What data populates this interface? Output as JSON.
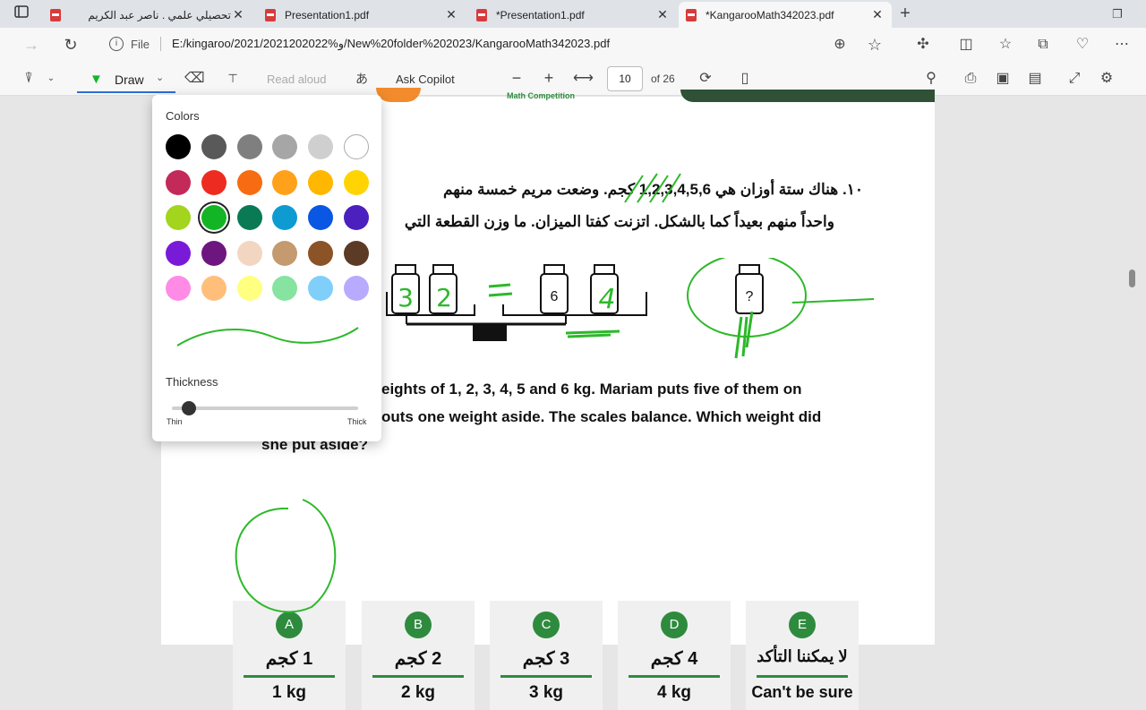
{
  "tabs": [
    {
      "label": "تحصيلي علمي . ناصر عبد الكريم",
      "active": false
    },
    {
      "label": "Presentation1.pdf",
      "active": false
    },
    {
      "label": "*Presentation1.pdf",
      "active": false
    },
    {
      "label": "*KangarooMath342023.pdf",
      "active": true
    }
  ],
  "address": {
    "info_label": "File",
    "url": "E:/kingaroo/2021/2021202022%و/New%20folder%202023/KangarooMath342023.pdf"
  },
  "pdf_toolbar": {
    "draw_label": "Draw",
    "read_aloud_label": "Read aloud",
    "copilot_label": "Ask Copilot",
    "page_number": "10",
    "page_total": "of 26"
  },
  "draw_panel": {
    "colors_heading": "Colors",
    "thickness_heading": "Thickness",
    "thin_label": "Thin",
    "thick_label": "Thick",
    "thickness_value": 0.1,
    "selected_color": "#13b524",
    "colors": [
      "#000000",
      "#595959",
      "#7f7f7f",
      "#a6a6a6",
      "#cfcfcf",
      "#ffffff",
      "#c32a59",
      "#ee2b20",
      "#f76c12",
      "#ffa11a",
      "#ffb700",
      "#ffd400",
      "#a3d41e",
      "#13b524",
      "#0a7a54",
      "#0e9bd1",
      "#0a57e3",
      "#4c1fbf",
      "#7a1ad9",
      "#6e1680",
      "#f3d6c1",
      "#c49a6e",
      "#8b5326",
      "#5c3b26",
      "#ff8be6",
      "#ffbf7a",
      "#ffff80",
      "#86e3a0",
      "#7fcffa",
      "#b8aaff"
    ]
  },
  "question": {
    "arabic_line1": "١٠. هناك ستة أوزان هي 1,2,3,4,5,6 كجم. وضعت مريم خمسة منهم",
    "arabic_line2": "واحداً منهم بعيداً كما بالشكل. اتزنت كفتا الميزان. ما وزن القطعة التي",
    "english_line1": "eights of 1, 2, 3, 4, 5 and 6 kg. Mariam puts five of them on",
    "english_line2": "outs one weight aside. The scales balance. Which weight did",
    "english_line3": "she put aside?",
    "printed_weight": "6",
    "mystery_weight": "?",
    "handwritten_left": [
      "3",
      "2"
    ],
    "handwritten_right": "4",
    "header_fragment": "Math Competition"
  },
  "choices": [
    {
      "letter": "A",
      "arabic": "1 كجم",
      "english": "1 kg"
    },
    {
      "letter": "B",
      "arabic": "2 كجم",
      "english": "2 kg"
    },
    {
      "letter": "C",
      "arabic": "3 كجم",
      "english": "3 kg"
    },
    {
      "letter": "D",
      "arabic": "4 كجم",
      "english": "4 kg"
    },
    {
      "letter": "E",
      "arabic": "لا يمكننا التأكد",
      "english": "Can't be sure"
    }
  ]
}
